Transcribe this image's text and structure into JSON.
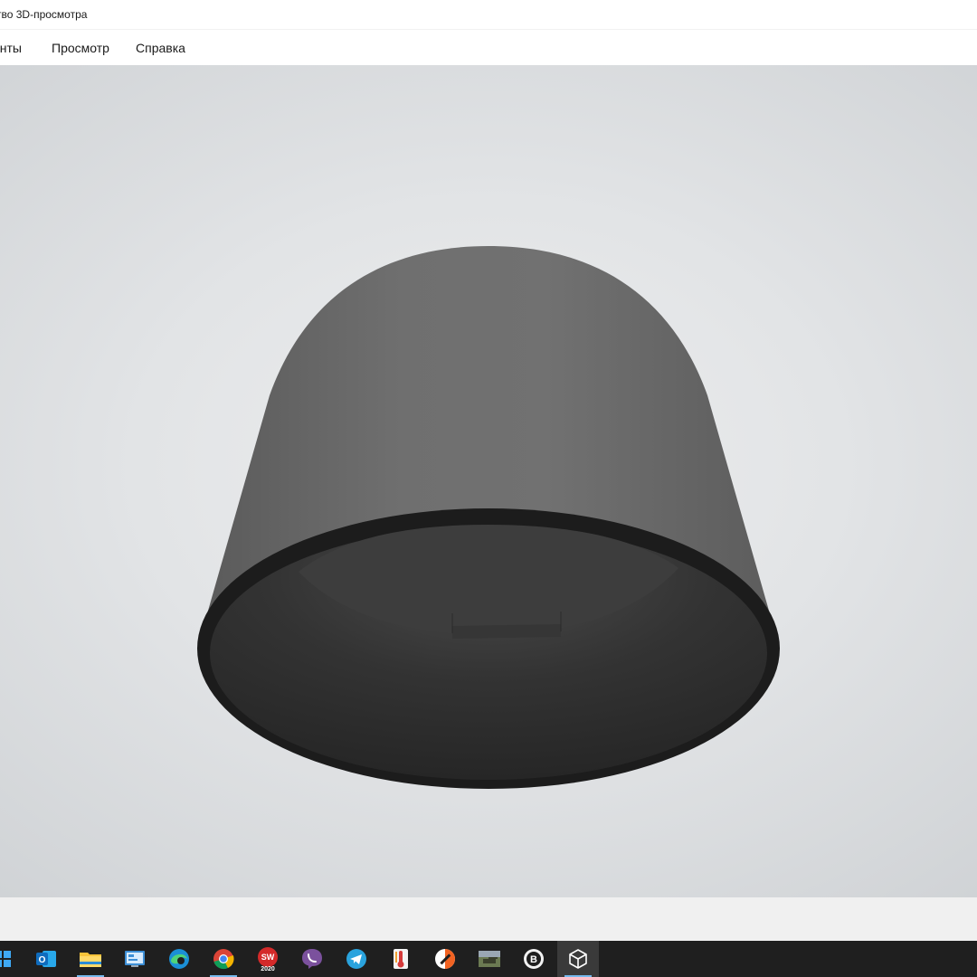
{
  "window": {
    "title": "тво 3D-просмотра"
  },
  "menubar": {
    "items": [
      {
        "label": "енты"
      },
      {
        "label": "Просмотр"
      },
      {
        "label": "Справка"
      }
    ]
  },
  "taskbar": {
    "icons": [
      {
        "name": "windows-start-icon"
      },
      {
        "name": "outlook-icon",
        "glyph": "O"
      },
      {
        "name": "file-explorer-icon"
      },
      {
        "name": "control-panel-icon"
      },
      {
        "name": "edge-icon"
      },
      {
        "name": "chrome-icon"
      },
      {
        "name": "solidworks-2020-icon",
        "glyph": "SW",
        "subglyph": "2020"
      },
      {
        "name": "viber-icon"
      },
      {
        "name": "telegram-icon"
      },
      {
        "name": "thermometer-app-icon"
      },
      {
        "name": "opera-gx-icon"
      },
      {
        "name": "world-of-tanks-icon"
      },
      {
        "name": "b-app-icon",
        "glyph": "B"
      },
      {
        "name": "3d-viewer-icon"
      }
    ]
  },
  "colors": {
    "accent": "#76b9ed",
    "taskbar": "#1f1f1f",
    "model_outer": "#6a6a6a",
    "model_inner": "#2c2c2c"
  }
}
